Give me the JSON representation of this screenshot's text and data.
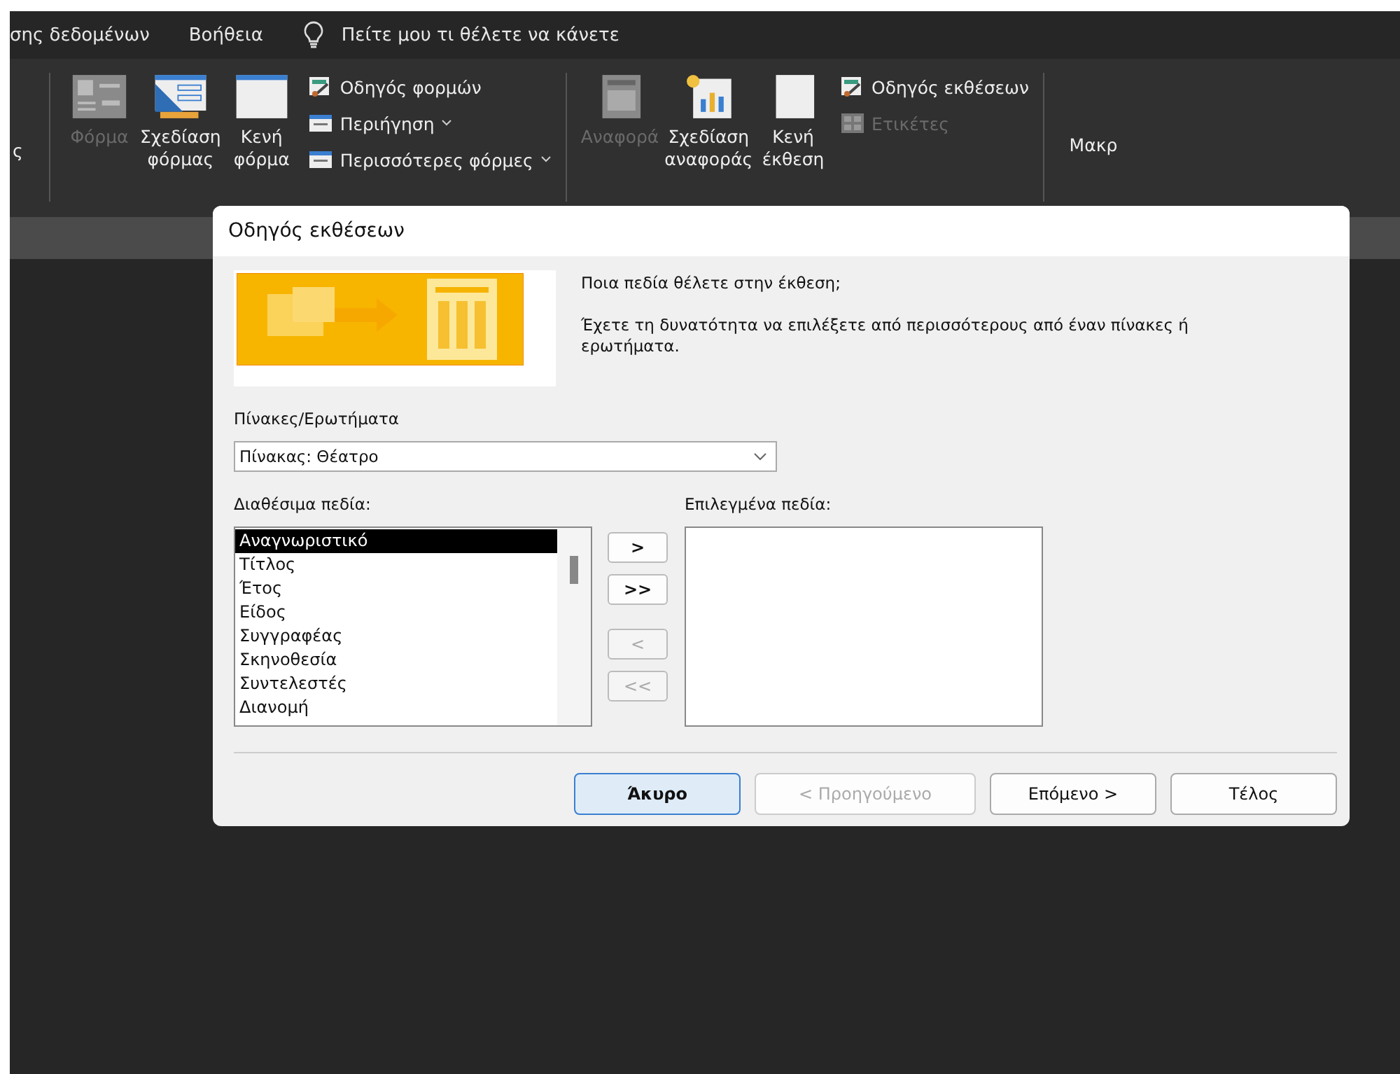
{
  "menu_bar": {
    "items": [
      "σης δεδομένων",
      "Βοήθεια"
    ],
    "tell_me": "Πείτε μου τι θέλετε να κάνετε"
  },
  "ribbon": {
    "cut_label": "ς",
    "groups": [
      {
        "large": [
          {
            "label": "Φόρμα",
            "disabled": true,
            "kind": "form"
          },
          {
            "label": "Σχεδίαση φόρμας",
            "disabled": false,
            "kind": "design"
          },
          {
            "label": "Κενή φόρμα",
            "disabled": false,
            "kind": "blank"
          }
        ],
        "small": [
          {
            "label": "Οδηγός φορμών",
            "disabled": false,
            "dropdown": false,
            "kind": "wizard"
          },
          {
            "label": "Περιήγηση",
            "disabled": false,
            "dropdown": true,
            "kind": "window"
          },
          {
            "label": "Περισσότερες φόρμες",
            "disabled": false,
            "dropdown": true,
            "kind": "window"
          }
        ]
      },
      {
        "large": [
          {
            "label": "Αναφορά",
            "disabled": true,
            "kind": "report"
          },
          {
            "label": "Σχεδίαση αναφοράς",
            "disabled": false,
            "kind": "chart"
          },
          {
            "label": "Κενή έκθεση",
            "disabled": false,
            "kind": "notebook"
          }
        ],
        "small": [
          {
            "label": "Οδηγός εκθέσεων",
            "disabled": false,
            "dropdown": false,
            "kind": "wizard"
          },
          {
            "label": "Ετικέτες",
            "disabled": true,
            "dropdown": false,
            "kind": "labels"
          }
        ]
      }
    ],
    "next_label": "Μακρ"
  },
  "dialog": {
    "title": "Οδηγός εκθέσεων",
    "question": "Ποια πεδία θέλετε στην έκθεση;",
    "hint": "Έχετε τη δυνατότητα να επιλέξετε από περισσότερους από έναν πίνακες ή ερωτήματα.",
    "source_label": "Πίνακες/Ερωτήματα",
    "source_value": "Πίνακας: Θέατρο",
    "available_label": "Διαθέσιμα πεδία:",
    "selected_label": "Επιλεγμένα πεδία:",
    "available_fields": [
      {
        "label": "Αναγνωριστικό",
        "selected": true
      },
      {
        "label": "Τίτλος",
        "selected": false
      },
      {
        "label": "Έτος",
        "selected": false
      },
      {
        "label": "Είδος",
        "selected": false
      },
      {
        "label": "Συγγραφέας",
        "selected": false
      },
      {
        "label": "Σκηνοθεσία",
        "selected": false
      },
      {
        "label": "Συντελεστές",
        "selected": false
      },
      {
        "label": "Διανομή",
        "selected": false
      }
    ],
    "move_buttons": [
      {
        "label": ">",
        "disabled": false
      },
      {
        "label": ">>",
        "disabled": false
      },
      {
        "label": "<",
        "disabled": true
      },
      {
        "label": "<<",
        "disabled": true
      }
    ],
    "buttons": [
      {
        "label": "Άκυρο",
        "disabled": false,
        "default": true
      },
      {
        "label": "< Προηγούμενο",
        "disabled": true,
        "default": false
      },
      {
        "label": "Επόμενο >",
        "disabled": false,
        "default": false
      },
      {
        "label": "Τέλος",
        "disabled": false,
        "default": false
      }
    ]
  }
}
